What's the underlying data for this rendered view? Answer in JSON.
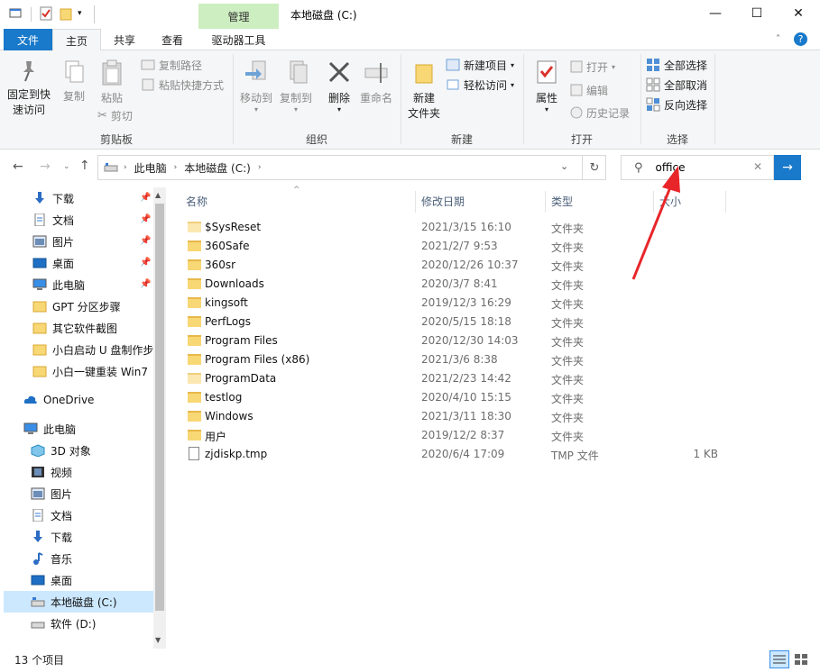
{
  "window": {
    "title": "本地磁盘 (C:)",
    "contextual_tab": "管理",
    "min_label": "—",
    "max_label": "☐",
    "close_label": "✕",
    "help_label": "?"
  },
  "tabs": [
    "文件",
    "主页",
    "共享",
    "查看",
    "驱动器工具"
  ],
  "ribbon": {
    "clipboard": {
      "pin_label": "固定到快\n速访问",
      "copy_label": "复制",
      "paste_label": "粘贴",
      "copy_path": "复制路径",
      "paste_shortcut": "粘贴快捷方式",
      "cut": "剪切",
      "group": "剪贴板"
    },
    "organize": {
      "move_to": "移动到",
      "copy_to": "复制到",
      "delete": "删除",
      "rename": "重命名",
      "group": "组织"
    },
    "new": {
      "new_folder": "新建\n文件夹",
      "new_item": "新建项目",
      "easy_access": "轻松访问",
      "group": "新建"
    },
    "open": {
      "properties": "属性",
      "open": "打开",
      "edit": "编辑",
      "history": "历史记录",
      "group": "打开"
    },
    "select": {
      "select_all": "全部选择",
      "select_none": "全部取消",
      "invert": "反向选择",
      "group": "选择"
    }
  },
  "address": {
    "crumbs": [
      "此电脑",
      "本地磁盘 (C:)"
    ],
    "search_value": "office"
  },
  "sidebar": {
    "quick": [
      {
        "label": "下载",
        "pinned": true
      },
      {
        "label": "文档",
        "pinned": true
      },
      {
        "label": "图片",
        "pinned": true
      },
      {
        "label": "桌面",
        "pinned": true
      },
      {
        "label": "此电脑",
        "pinned": true
      },
      {
        "label": "GPT 分区步骤",
        "pinned": false
      },
      {
        "label": "其它软件截图",
        "pinned": false
      },
      {
        "label": "小白启动 U 盘制作步",
        "pinned": false
      },
      {
        "label": "小白一键重装 Win7 ",
        "pinned": false
      }
    ],
    "onedrive": "OneDrive",
    "thispc": "此电脑",
    "pc_items": [
      "3D 对象",
      "视频",
      "图片",
      "文档",
      "下载",
      "音乐",
      "桌面",
      "本地磁盘 (C:)",
      "软件 (D:)"
    ]
  },
  "columns": {
    "name": "名称",
    "date": "修改日期",
    "type": "类型",
    "size": "大小"
  },
  "files": [
    {
      "name": "$SysReset",
      "date": "2021/3/15 16:10",
      "type": "文件夹",
      "size": "",
      "kind": "folder-pale"
    },
    {
      "name": "360Safe",
      "date": "2021/2/7 9:53",
      "type": "文件夹",
      "size": "",
      "kind": "folder"
    },
    {
      "name": "360sr",
      "date": "2020/12/26 10:37",
      "type": "文件夹",
      "size": "",
      "kind": "folder"
    },
    {
      "name": "Downloads",
      "date": "2020/3/7 8:41",
      "type": "文件夹",
      "size": "",
      "kind": "folder"
    },
    {
      "name": "kingsoft",
      "date": "2019/12/3 16:29",
      "type": "文件夹",
      "size": "",
      "kind": "folder"
    },
    {
      "name": "PerfLogs",
      "date": "2020/5/15 18:18",
      "type": "文件夹",
      "size": "",
      "kind": "folder"
    },
    {
      "name": "Program Files",
      "date": "2020/12/30 14:03",
      "type": "文件夹",
      "size": "",
      "kind": "folder"
    },
    {
      "name": "Program Files (x86)",
      "date": "2021/3/6 8:38",
      "type": "文件夹",
      "size": "",
      "kind": "folder"
    },
    {
      "name": "ProgramData",
      "date": "2021/2/23 14:42",
      "type": "文件夹",
      "size": "",
      "kind": "folder-pale"
    },
    {
      "name": "testlog",
      "date": "2020/4/10 15:15",
      "type": "文件夹",
      "size": "",
      "kind": "folder"
    },
    {
      "name": "Windows",
      "date": "2021/3/11 18:30",
      "type": "文件夹",
      "size": "",
      "kind": "folder"
    },
    {
      "name": "用户",
      "date": "2019/12/2 8:37",
      "type": "文件夹",
      "size": "",
      "kind": "folder"
    },
    {
      "name": "zjdiskp.tmp",
      "date": "2020/6/4 17:09",
      "type": "TMP 文件",
      "size": "1 KB",
      "kind": "file"
    }
  ],
  "status": {
    "count": "13 个项目"
  },
  "colors": {
    "accent": "#1979ca",
    "manage_tab": "#cdeec0",
    "arrow": "#e8262a"
  }
}
